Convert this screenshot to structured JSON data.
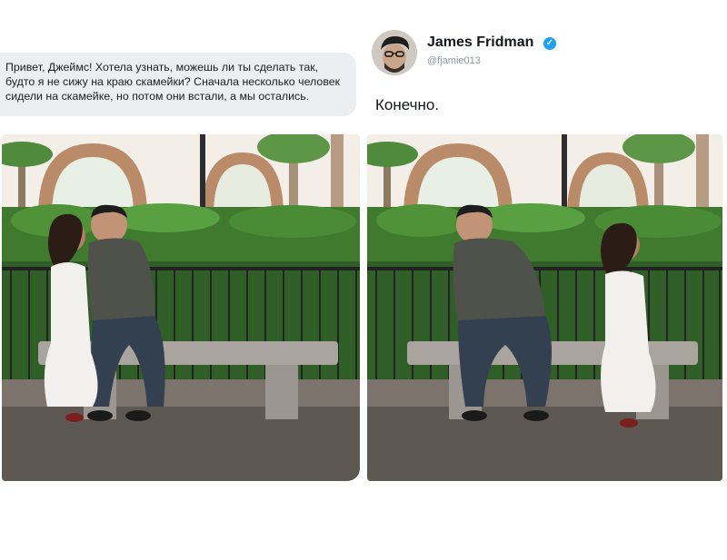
{
  "request": {
    "text": "Привет, Джеймс! Хотела узнать, можешь ли ты сделать так, будто я не сижу на краю скамейки? Сначала несколько человек сидели на скамейке, но потом они встали, а мы остались."
  },
  "reply": {
    "author_name": "James Fridman",
    "handle": "@fjamie013",
    "text": "Конечно.",
    "verified_icon": "verified-badge-icon"
  },
  "colors": {
    "bubble_bg": "#eceef0",
    "verified_blue": "#1da1f2",
    "handle_gray": "#8899a6"
  }
}
